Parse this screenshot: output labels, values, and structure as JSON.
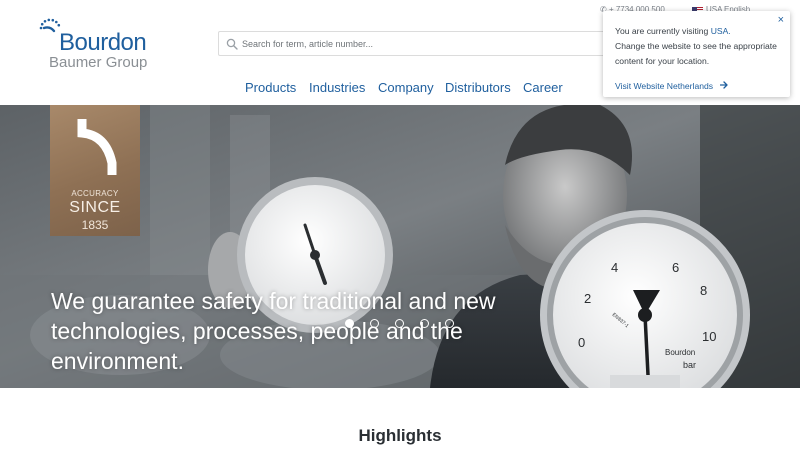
{
  "brand": {
    "name": "Bourdon",
    "group": "Baumer Group"
  },
  "utility": {
    "phone": "+ 7734 000 500",
    "country": "USA",
    "language": "English"
  },
  "search": {
    "placeholder": "Search for term, article number..."
  },
  "nav": {
    "items": [
      "Products",
      "Industries",
      "Company",
      "Distributors",
      "Career"
    ]
  },
  "popup": {
    "line1_prefix": "You are currently visiting",
    "country": "USA.",
    "line2": "Change the website to see the appropriate content for your location.",
    "link": "Visit Website Netherlands",
    "close": "×"
  },
  "hero": {
    "badge": {
      "line1": "ACCURACY",
      "line2": "SINCE",
      "line3": "1835"
    },
    "headline": "We guarantee safety for traditional and new technologies, processes, people and the environment.",
    "gauge_brand": "Bourdon",
    "gauge_unit": "bar",
    "gauge_model": "EN837-1",
    "slides": 5,
    "active_slide": 1
  },
  "section": {
    "title": "Highlights"
  },
  "colors": {
    "brand_blue": "#1f5f9e",
    "badge_bronze": "#8e7054"
  }
}
